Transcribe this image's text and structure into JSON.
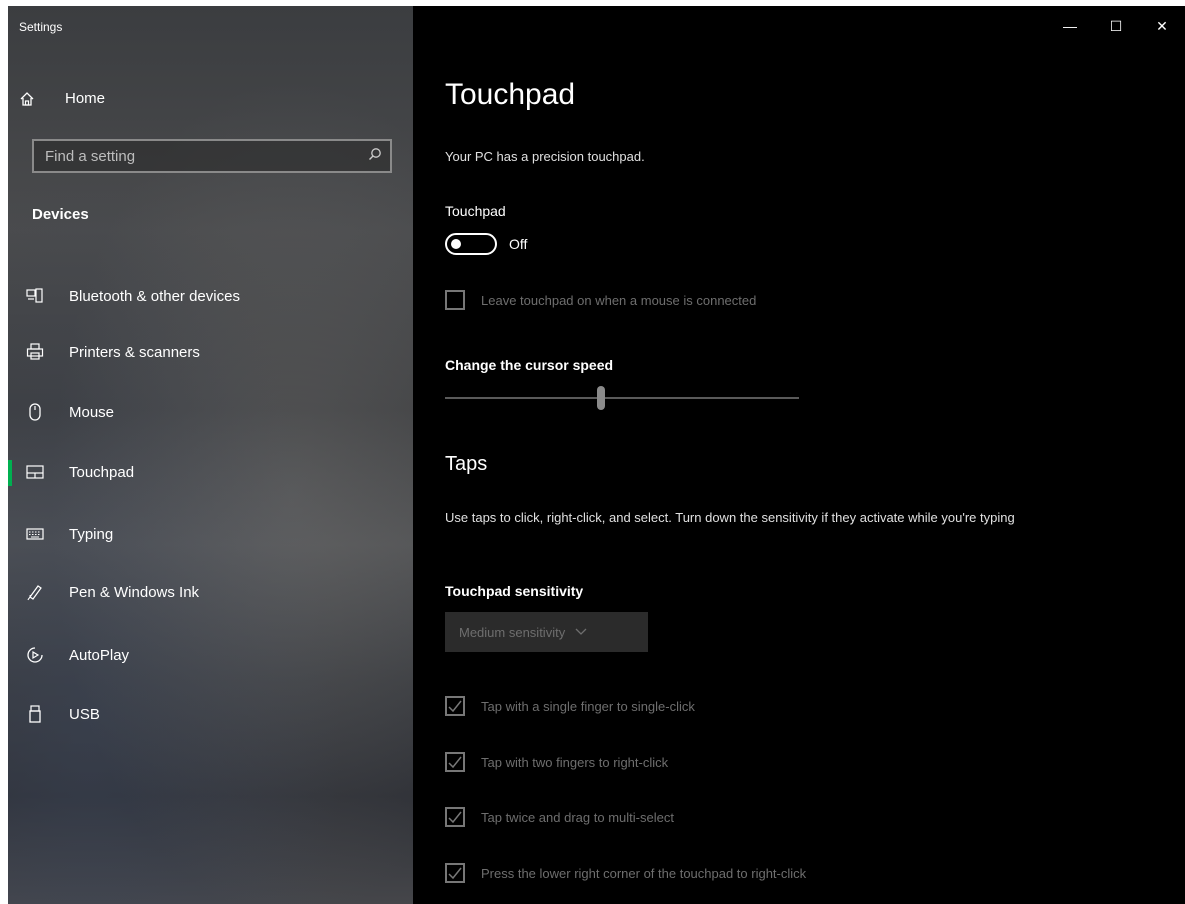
{
  "window": {
    "title": "Settings",
    "controls": {
      "minimize": "—",
      "maximize": "☐",
      "close": "✕"
    }
  },
  "sidebar": {
    "home_label": "Home",
    "search": {
      "placeholder": "Find a setting",
      "value": ""
    },
    "section_label": "Devices",
    "items": [
      {
        "label": "Bluetooth & other devices",
        "icon": "bluetooth-devices-icon",
        "active": false
      },
      {
        "label": "Printers & scanners",
        "icon": "printer-icon",
        "active": false
      },
      {
        "label": "Mouse",
        "icon": "mouse-icon",
        "active": false
      },
      {
        "label": "Touchpad",
        "icon": "touchpad-icon",
        "active": true
      },
      {
        "label": "Typing",
        "icon": "keyboard-icon",
        "active": false
      },
      {
        "label": "Pen & Windows Ink",
        "icon": "pen-icon",
        "active": false
      },
      {
        "label": "AutoPlay",
        "icon": "autoplay-icon",
        "active": false
      },
      {
        "label": "USB",
        "icon": "usb-icon",
        "active": false
      }
    ],
    "accent_color": "#00b050"
  },
  "main": {
    "title": "Touchpad",
    "subtitle": "Your PC has a precision touchpad.",
    "touchpad_label": "Touchpad",
    "touchpad_toggle": {
      "state": "Off",
      "on": false
    },
    "leave_on_checkbox": {
      "label": "Leave touchpad on when a mouse is connected",
      "checked": false,
      "enabled": false
    },
    "cursor_speed_label": "Change the cursor speed",
    "cursor_speed_value": 0.44,
    "taps": {
      "title": "Taps",
      "description": "Use taps to click, right-click, and select. Turn down the sensitivity if they activate while you're typing",
      "sensitivity_label": "Touchpad sensitivity",
      "sensitivity_value": "Medium sensitivity",
      "options": [
        {
          "label": "Tap with a single finger to single-click",
          "checked": true
        },
        {
          "label": "Tap with two fingers to right-click",
          "checked": true
        },
        {
          "label": "Tap twice and drag to multi-select",
          "checked": true
        },
        {
          "label": "Press the lower right corner of the touchpad to right-click",
          "checked": true
        }
      ]
    }
  }
}
